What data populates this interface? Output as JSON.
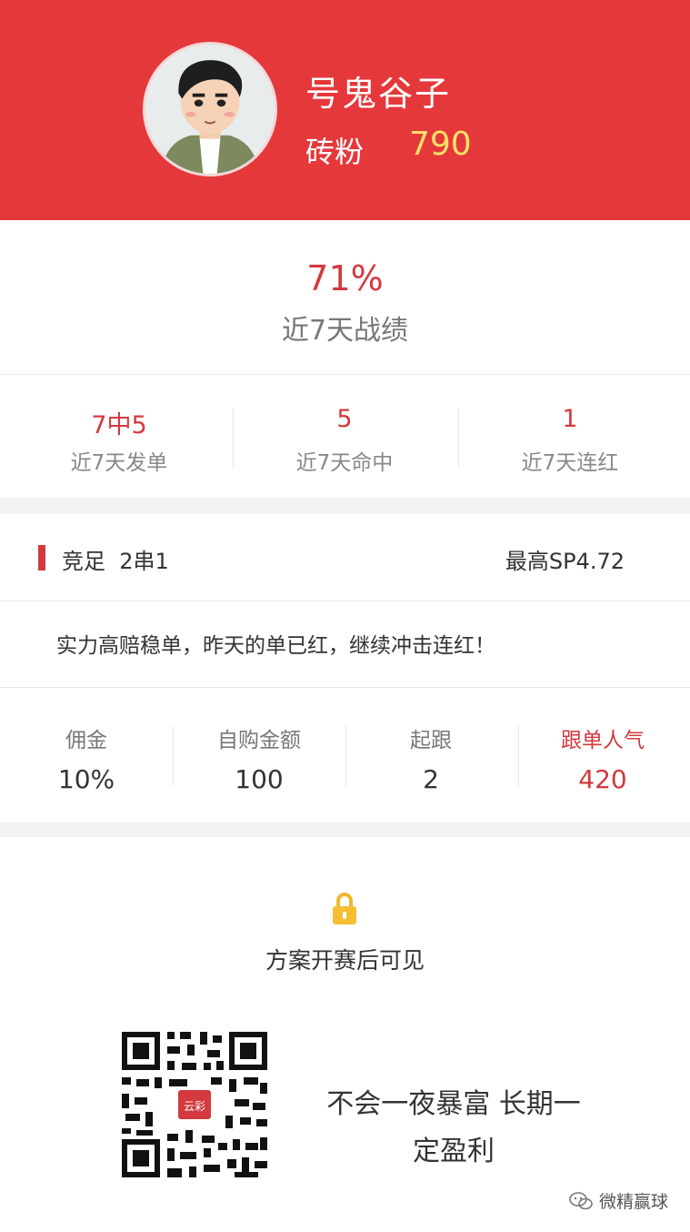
{
  "profile": {
    "name": "号鬼谷子",
    "fans_label": "砖粉",
    "fans_count": "790"
  },
  "summary": {
    "win_rate": "71%",
    "win_rate_label": "近7天战绩"
  },
  "stats": [
    {
      "value": "7中5",
      "label": "近7天发单"
    },
    {
      "value": "5",
      "label": "近7天命中"
    },
    {
      "value": "1",
      "label": "近7天连红"
    }
  ],
  "bet": {
    "type": "竞足  2串1",
    "max_sp": "最高SP4.72"
  },
  "description": "实力高赔稳单，昨天的单已红，继续冲击连红！",
  "plan_stats": [
    {
      "label": "佣金",
      "value": "10%"
    },
    {
      "label": "自购金额",
      "value": "100"
    },
    {
      "label": "起跟",
      "value": "2"
    },
    {
      "label": "跟单人气",
      "value": "420"
    }
  ],
  "lock_notice": "方案开赛后可见",
  "qr": {
    "brand": "云彩"
  },
  "slogan": {
    "line1": "不会一夜暴富 长期一",
    "line2": "定盈利"
  },
  "watermark": "微精赢球",
  "colors": {
    "header_red": "#e5383b",
    "accent_red": "#d3393e",
    "fans_yellow": "#ffe066"
  }
}
